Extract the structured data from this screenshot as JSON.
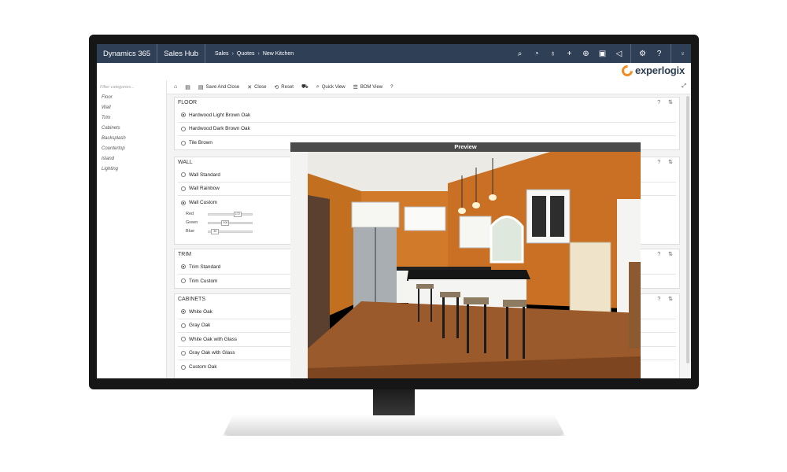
{
  "nav": {
    "app_name": "Dynamics 365",
    "module": "Sales Hub",
    "breadcrumb": [
      "Sales",
      "Quotes",
      "New Kitchen"
    ],
    "icons": [
      "search-icon",
      "task-icon",
      "lightbulb-icon",
      "plus-icon",
      "filter-icon",
      "assistant-icon",
      "back-icon",
      "settings-icon",
      "help-icon",
      "user-icon"
    ]
  },
  "brand": {
    "logo_text": "experlogix",
    "accent": "#f28c1e"
  },
  "sidebar": {
    "filter_placeholder": "Filter categories...",
    "categories": [
      "Floor",
      "Wall",
      "Trim",
      "Cabinets",
      "Backsplash",
      "Countertop",
      "Island",
      "Lighting"
    ]
  },
  "toolbar": {
    "save_close": "Save And Close",
    "close": "Close",
    "reset": "Reset",
    "quick_view": "Quick View",
    "bom_view": "BOM View",
    "help": "?"
  },
  "sections": {
    "floor": {
      "title": "FLOOR",
      "options": [
        {
          "label": "Hardwood Light Brown Oak",
          "selected": true
        },
        {
          "label": "Hardwood Dark Brown Oak",
          "selected": false
        },
        {
          "label": "Tile Brown",
          "selected": false
        }
      ]
    },
    "wall": {
      "title": "WALL",
      "options": [
        {
          "label": "Wall Standard",
          "selected": false
        },
        {
          "label": "Wall Rainbow",
          "selected": false
        },
        {
          "label": "Wall Custom",
          "selected": true
        }
      ],
      "sliders": [
        {
          "label": "Red",
          "value": "172",
          "fraction": 0.67
        },
        {
          "label": "Green",
          "value": "100",
          "fraction": 0.39
        },
        {
          "label": "Blue",
          "value": "39",
          "fraction": 0.15
        }
      ]
    },
    "trim": {
      "title": "TRIM",
      "options": [
        {
          "label": "Trim Standard",
          "selected": true
        },
        {
          "label": "Trim Custom",
          "selected": false
        }
      ]
    },
    "cabinets": {
      "title": "CABINETS",
      "options": [
        {
          "label": "White Oak",
          "selected": true
        },
        {
          "label": "Gray Oak",
          "selected": false
        },
        {
          "label": "White Oak with Glass",
          "selected": false
        },
        {
          "label": "Gray Oak with Glass",
          "selected": false
        },
        {
          "label": "Custom Oak",
          "selected": false
        }
      ]
    },
    "section_tools": "? ⇅"
  },
  "preview": {
    "title": "Preview"
  }
}
